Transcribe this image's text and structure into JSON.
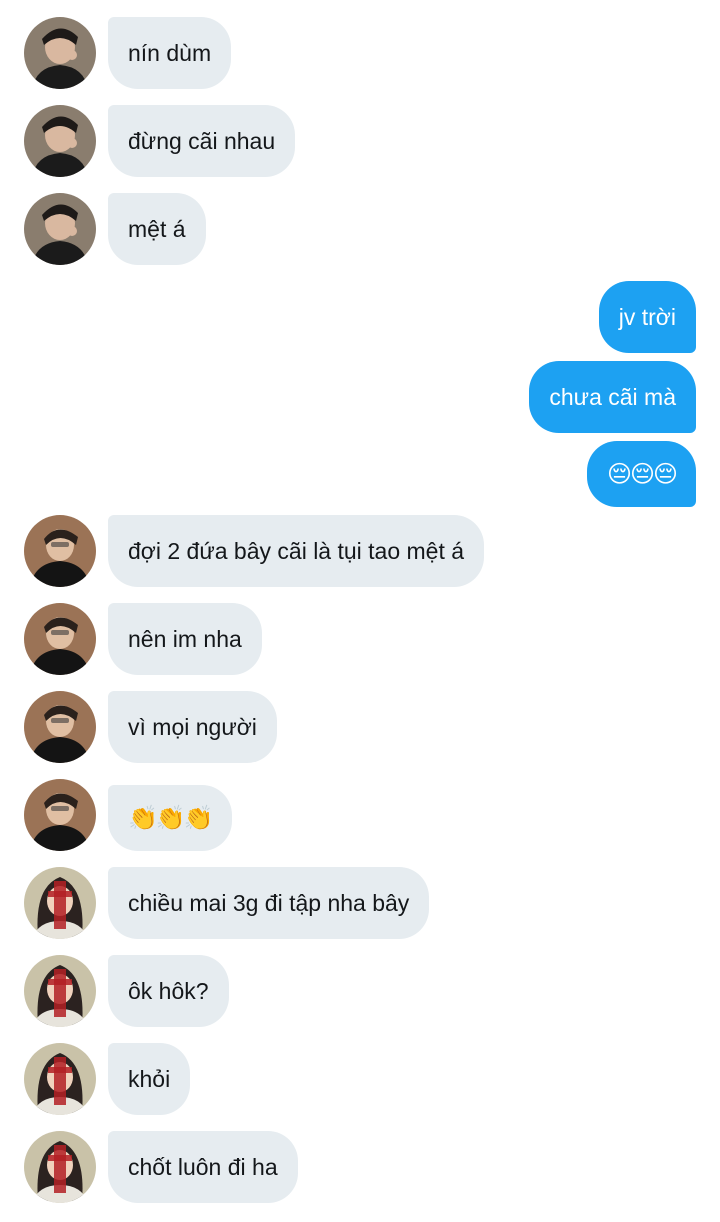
{
  "conversation": {
    "messages": [
      {
        "side": "in",
        "avatar": "user-a",
        "text": "nín dùm"
      },
      {
        "side": "in",
        "avatar": "user-a",
        "text": "đừng cãi nhau"
      },
      {
        "side": "in",
        "avatar": "user-a",
        "text": "mệt á"
      },
      {
        "side": "out",
        "text": "jv trời"
      },
      {
        "side": "out",
        "text": "chưa cãi mà"
      },
      {
        "side": "out",
        "text": "😔😔😔"
      },
      {
        "side": "in",
        "avatar": "user-b",
        "text": "đợi 2 đứa bây cãi là tụi tao mệt á"
      },
      {
        "side": "in",
        "avatar": "user-b",
        "text": "nên im nha"
      },
      {
        "side": "in",
        "avatar": "user-b",
        "text": "vì mọi người"
      },
      {
        "side": "in",
        "avatar": "user-b",
        "text": "👏👏👏"
      },
      {
        "side": "in",
        "avatar": "user-c",
        "text": "chiều mai 3g đi tập nha bây"
      },
      {
        "side": "in",
        "avatar": "user-c",
        "text": "ôk hôk?"
      },
      {
        "side": "in",
        "avatar": "user-c",
        "text": "khỏi"
      },
      {
        "side": "in",
        "avatar": "user-c",
        "text": "chốt luôn đi ha"
      }
    ]
  },
  "colors": {
    "incoming_bubble": "#e6ecf0",
    "outgoing_bubble": "#1da1f2",
    "incoming_text": "#14171a",
    "outgoing_text": "#ffffff"
  }
}
